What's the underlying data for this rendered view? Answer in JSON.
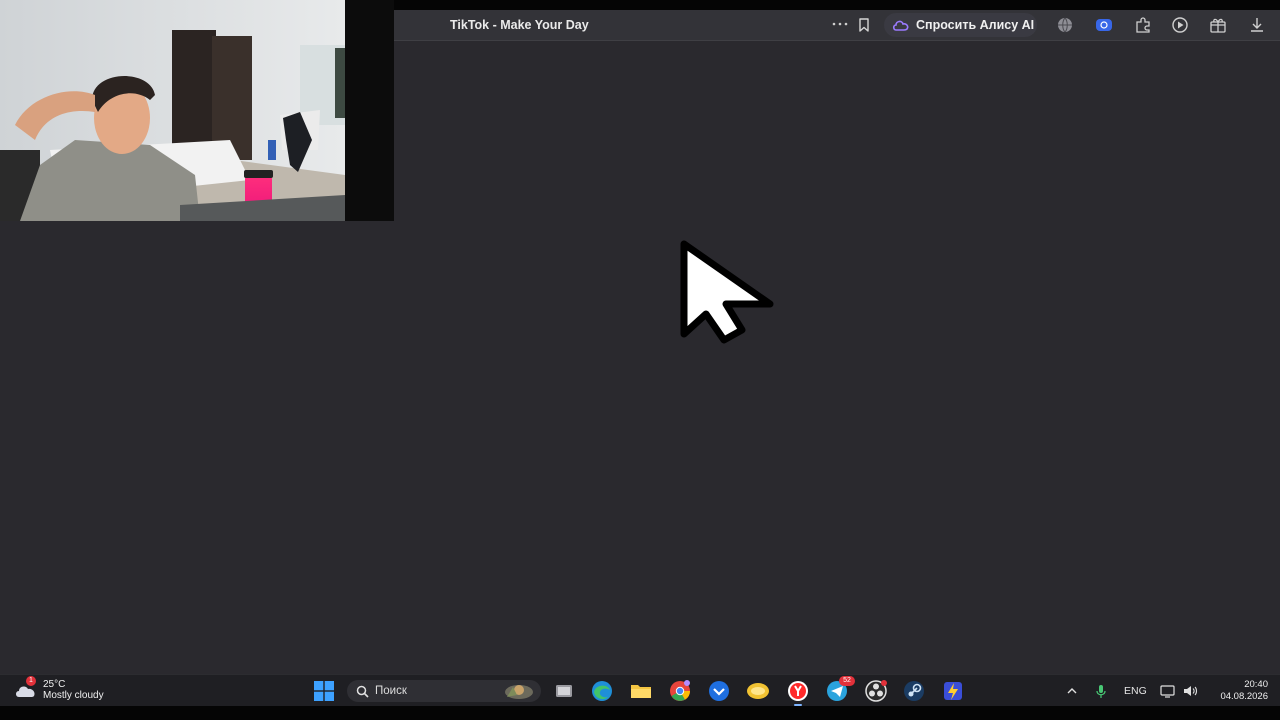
{
  "browser": {
    "tab_title": "TikTok - Make Your Day",
    "more_icon": "ellipsis-icon",
    "bookmark_icon": "bookmark-icon",
    "alice_button_label": "Спросить Алису AI",
    "toolbar_icons": [
      "globe-icon",
      "vpn-badge-icon",
      "extensions-icon",
      "media-player-icon",
      "gift-icon",
      "download-icon"
    ],
    "accent_color": "#7a5cff"
  },
  "webcam": {
    "description_icon": "webcam-overlay"
  },
  "taskbar": {
    "weather": {
      "badge_count": "1",
      "temperature": "25°C",
      "condition": "Mostly cloudy"
    },
    "search_placeholder": "Поиск",
    "apps": [
      {
        "name": "task-view-icon"
      },
      {
        "name": "edge-icon"
      },
      {
        "name": "file-explorer-icon"
      },
      {
        "name": "chrome-icon"
      },
      {
        "name": "mail-icon"
      },
      {
        "name": "chat-app-icon"
      },
      {
        "name": "yandex-browser-icon"
      },
      {
        "name": "telegram-icon",
        "badge": "52"
      },
      {
        "name": "obs-icon"
      },
      {
        "name": "steam-icon"
      },
      {
        "name": "flash-app-icon"
      }
    ],
    "tray": {
      "language": "ENG",
      "time": "20:40",
      "date": "04.08.2026"
    }
  }
}
